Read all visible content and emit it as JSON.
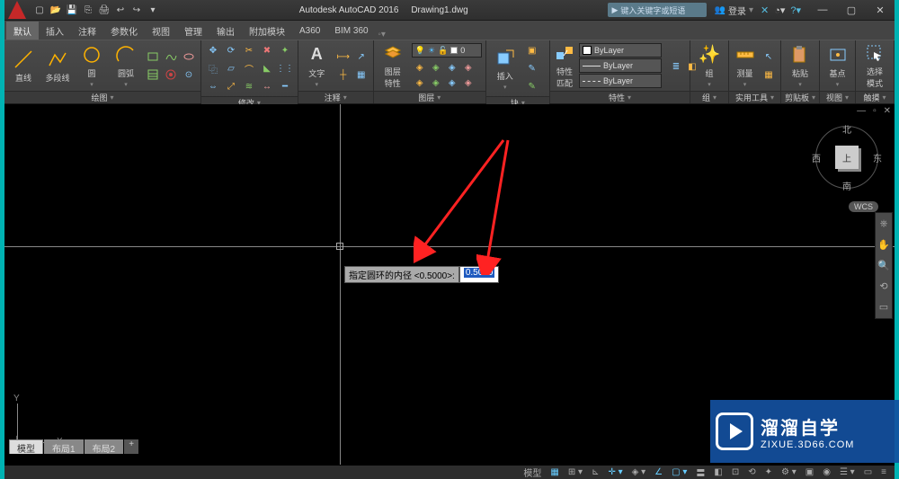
{
  "title": {
    "app": "Autodesk AutoCAD 2016",
    "file": "Drawing1.dwg"
  },
  "search": {
    "placeholder": "键入关键字或短语"
  },
  "user": {
    "label": "登录"
  },
  "tabs": {
    "menu": "默认",
    "items": [
      "插入",
      "注释",
      "参数化",
      "视图",
      "管理",
      "输出",
      "附加模块",
      "A360",
      "BIM 360"
    ]
  },
  "ribbon": {
    "draw": {
      "title": "绘图",
      "line": "直线",
      "polyline": "多段线",
      "circle": "圆",
      "arc": "圆弧"
    },
    "modify": {
      "title": "修改"
    },
    "annot": {
      "title": "注释",
      "text": "文字"
    },
    "layers": {
      "title": "图层",
      "btn": "图层\n特性"
    },
    "block": {
      "title": "块",
      "insert": "插入"
    },
    "prop": {
      "title": "特性",
      "btn": "特性\n匹配",
      "l1": "ByLayer",
      "l2": "ByLayer",
      "l3": "ByLayer"
    },
    "group": {
      "title": "组",
      "btn": "组"
    },
    "util": {
      "title": "实用工具",
      "btn": "测量"
    },
    "clip": {
      "title": "剪贴板",
      "btn": "粘贴"
    },
    "view": {
      "title": "视图",
      "btn": "基点"
    },
    "touch": {
      "title": "触摸",
      "btn": "选择\n模式"
    }
  },
  "dyninput": {
    "prompt": "指定圆环的内径 <0.5000>:",
    "value": "0.5000"
  },
  "viewcube": {
    "top": "上",
    "n": "北",
    "s": "南",
    "e": "东",
    "w": "西",
    "wcs": "WCS"
  },
  "ucs": {
    "x": "X",
    "y": "Y"
  },
  "doctabs": {
    "model": "模型",
    "layout1": "布局1",
    "layout2": "布局2"
  },
  "status": {
    "model": "模型"
  },
  "watermark": {
    "cn": "溜溜自学",
    "en": "ZIXUE.3D66.COM"
  }
}
